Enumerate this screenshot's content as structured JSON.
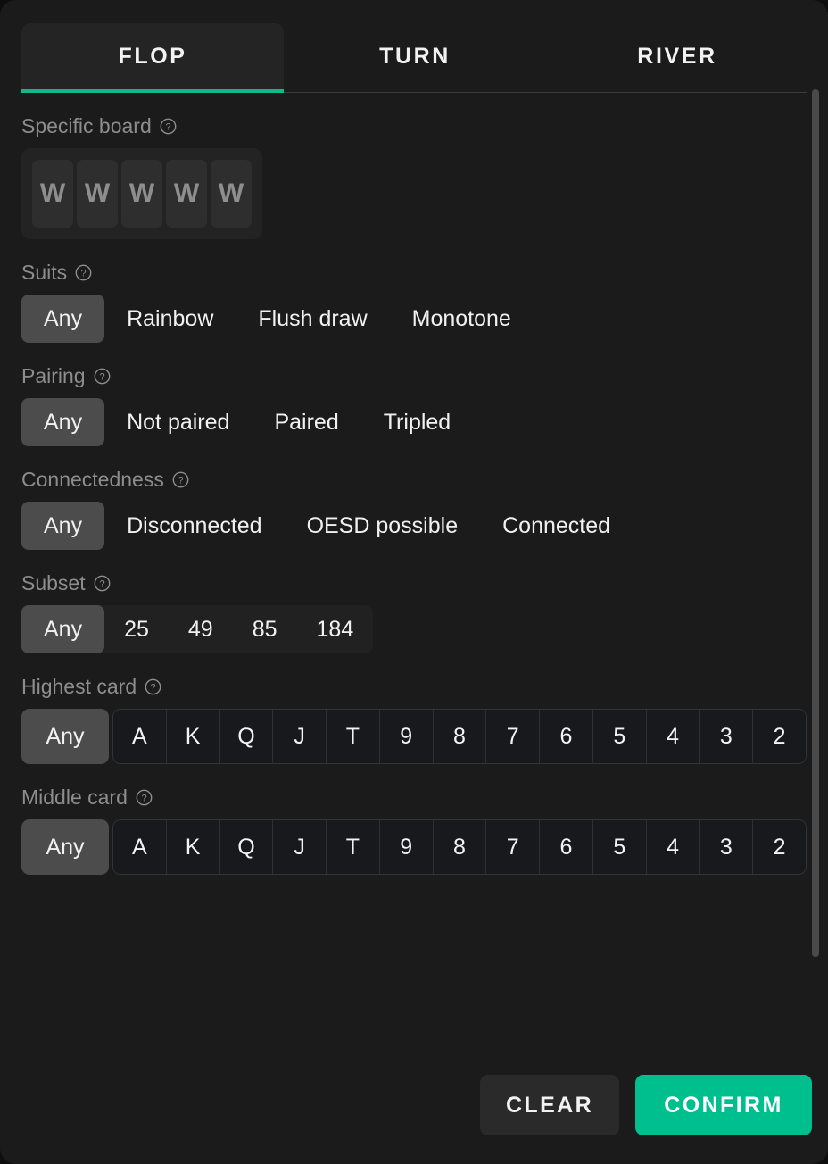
{
  "theme": {
    "panel_bg": "#1b1b1b",
    "page_bg": "#0e0e0e",
    "accent": "#00bf8f",
    "tab_underline": "#10b98b",
    "selected_pill_bg": "#4c4c4c",
    "label_color": "#8d8d8d",
    "text_color": "#f1f1f1"
  },
  "tabs": [
    {
      "label": "FLOP",
      "active": true
    },
    {
      "label": "TURN",
      "active": false
    },
    {
      "label": "RIVER",
      "active": false
    }
  ],
  "groups": {
    "specific_board": {
      "label": "Specific board",
      "help_icon": "help-circle-icon",
      "cards": [
        {
          "value": "W"
        },
        {
          "value": "W"
        },
        {
          "value": "W"
        },
        {
          "value": "W"
        },
        {
          "value": "W"
        }
      ]
    },
    "suits": {
      "label": "Suits",
      "help_icon": "help-circle-icon",
      "selected": "Any",
      "options": [
        "Any",
        "Rainbow",
        "Flush draw",
        "Monotone"
      ]
    },
    "pairing": {
      "label": "Pairing",
      "help_icon": "help-circle-icon",
      "selected": "Any",
      "options": [
        "Any",
        "Not paired",
        "Paired",
        "Tripled"
      ]
    },
    "connectedness": {
      "label": "Connectedness",
      "help_icon": "help-circle-icon",
      "selected": "Any",
      "options": [
        "Any",
        "Disconnected",
        "OESD possible",
        "Connected"
      ]
    },
    "subset": {
      "label": "Subset",
      "help_icon": "help-circle-icon",
      "selected": "Any",
      "options": [
        "Any",
        "25",
        "49",
        "85",
        "184"
      ]
    },
    "highest_card": {
      "label": "Highest card",
      "help_icon": "help-circle-icon",
      "selected": "Any",
      "any_label": "Any",
      "ranks": [
        "A",
        "K",
        "Q",
        "J",
        "T",
        "9",
        "8",
        "7",
        "6",
        "5",
        "4",
        "3",
        "2"
      ]
    },
    "middle_card": {
      "label": "Middle card",
      "help_icon": "help-circle-icon",
      "selected": "Any",
      "any_label": "Any",
      "ranks": [
        "A",
        "K",
        "Q",
        "J",
        "T",
        "9",
        "8",
        "7",
        "6",
        "5",
        "4",
        "3",
        "2"
      ]
    }
  },
  "footer": {
    "clear_label": "CLEAR",
    "confirm_label": "CONFIRM"
  },
  "scrollbar": {
    "name": "vertical-scrollbar"
  }
}
